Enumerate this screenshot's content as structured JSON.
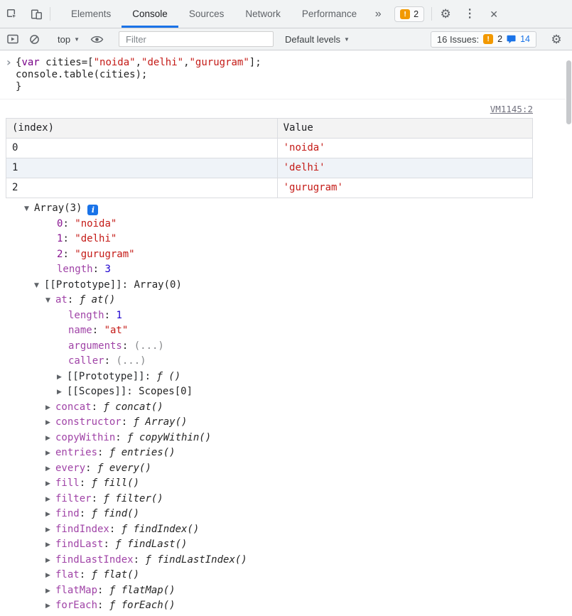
{
  "colors": {
    "accent_blue": "#1a73e8",
    "string_red": "#c41a16",
    "property_purple": "#881391",
    "number_blue": "#1c00cf",
    "warning_amber": "#f29900"
  },
  "icons": {
    "warning": "!",
    "info": "i",
    "more_tabs": "»",
    "overflow_menu": "⋮",
    "close": "✕",
    "settings": "⚙",
    "caret_down": "▼",
    "input_chevron": "›",
    "tree_open": "▼",
    "tree_closed": "▶"
  },
  "tabbar": {
    "tabs": [
      {
        "label": "Elements",
        "active": false
      },
      {
        "label": "Console",
        "active": true
      },
      {
        "label": "Sources",
        "active": false
      },
      {
        "label": "Network",
        "active": false
      },
      {
        "label": "Performance",
        "active": false
      }
    ],
    "issues_badge_count": "2"
  },
  "toolbar": {
    "context_value": "top",
    "filter_placeholder": "Filter",
    "filter_value": "",
    "levels_value": "Default levels",
    "issues_label": "16 Issues:",
    "issues_error_count": "2",
    "issues_message_count": "14"
  },
  "console": {
    "input_lines": [
      [
        {
          "t": "{",
          "s": "plain"
        },
        {
          "t": "var",
          "s": "keyword"
        },
        {
          "t": " cities=[",
          "s": "plain"
        },
        {
          "t": "\"noida\"",
          "s": "string"
        },
        {
          "t": ",",
          "s": "plain"
        },
        {
          "t": "\"delhi\"",
          "s": "string"
        },
        {
          "t": ",",
          "s": "plain"
        },
        {
          "t": "\"gurugram\"",
          "s": "string"
        },
        {
          "t": "];",
          "s": "plain"
        }
      ],
      [
        {
          "t": "console.table(cities);",
          "s": "plain"
        }
      ],
      [
        {
          "t": "}",
          "s": "plain"
        }
      ]
    ],
    "message": {
      "source_link": "VM1145:2",
      "table": {
        "headers": [
          "(index)",
          "Value"
        ],
        "rows": [
          {
            "index": "0",
            "value": "'noida'"
          },
          {
            "index": "1",
            "value": "'delhi'"
          },
          {
            "index": "2",
            "value": "'gurugram'"
          }
        ]
      }
    },
    "result_tree": {
      "root_label": "Array(3)",
      "root_expanded": true,
      "rows": [
        {
          "key": "0",
          "value": "\"noida\"",
          "vtype": "string",
          "depth": 1,
          "expand": "none",
          "enumerable": true
        },
        {
          "key": "1",
          "value": "\"delhi\"",
          "vtype": "string",
          "depth": 1,
          "expand": "none",
          "enumerable": true
        },
        {
          "key": "2",
          "value": "\"gurugram\"",
          "vtype": "string",
          "depth": 1,
          "expand": "none",
          "enumerable": true
        },
        {
          "key": "length",
          "value": "3",
          "vtype": "number",
          "depth": 1,
          "expand": "none"
        },
        {
          "key": "[[Prototype]]",
          "value": "Array(0)",
          "vtype": "plain",
          "depth": 1,
          "expand": "open",
          "internal": true
        },
        {
          "key": "at",
          "value": "ƒ at()",
          "vtype": "function",
          "depth": 2,
          "expand": "open"
        },
        {
          "key": "length",
          "value": "1",
          "vtype": "number",
          "depth": 3,
          "expand": "none"
        },
        {
          "key": "name",
          "value": "\"at\"",
          "vtype": "string",
          "depth": 3,
          "expand": "none"
        },
        {
          "key": "arguments",
          "value": "(...)",
          "vtype": "muted",
          "depth": 3,
          "expand": "none"
        },
        {
          "key": "caller",
          "value": "(...)",
          "vtype": "muted",
          "depth": 3,
          "expand": "none"
        },
        {
          "key": "[[Prototype]]",
          "value": "ƒ ()",
          "vtype": "function",
          "depth": 3,
          "expand": "closed",
          "internal": true
        },
        {
          "key": "[[Scopes]]",
          "value": "Scopes[0]",
          "vtype": "plain",
          "depth": 3,
          "expand": "closed",
          "internal": true
        },
        {
          "key": "concat",
          "value": "ƒ concat()",
          "vtype": "function",
          "depth": 2,
          "expand": "closed"
        },
        {
          "key": "constructor",
          "value": "ƒ Array()",
          "vtype": "function",
          "depth": 2,
          "expand": "closed"
        },
        {
          "key": "copyWithin",
          "value": "ƒ copyWithin()",
          "vtype": "function",
          "depth": 2,
          "expand": "closed"
        },
        {
          "key": "entries",
          "value": "ƒ entries()",
          "vtype": "function",
          "depth": 2,
          "expand": "closed"
        },
        {
          "key": "every",
          "value": "ƒ every()",
          "vtype": "function",
          "depth": 2,
          "expand": "closed"
        },
        {
          "key": "fill",
          "value": "ƒ fill()",
          "vtype": "function",
          "depth": 2,
          "expand": "closed"
        },
        {
          "key": "filter",
          "value": "ƒ filter()",
          "vtype": "function",
          "depth": 2,
          "expand": "closed"
        },
        {
          "key": "find",
          "value": "ƒ find()",
          "vtype": "function",
          "depth": 2,
          "expand": "closed"
        },
        {
          "key": "findIndex",
          "value": "ƒ findIndex()",
          "vtype": "function",
          "depth": 2,
          "expand": "closed"
        },
        {
          "key": "findLast",
          "value": "ƒ findLast()",
          "vtype": "function",
          "depth": 2,
          "expand": "closed"
        },
        {
          "key": "findLastIndex",
          "value": "ƒ findLastIndex()",
          "vtype": "function",
          "depth": 2,
          "expand": "closed"
        },
        {
          "key": "flat",
          "value": "ƒ flat()",
          "vtype": "function",
          "depth": 2,
          "expand": "closed"
        },
        {
          "key": "flatMap",
          "value": "ƒ flatMap()",
          "vtype": "function",
          "depth": 2,
          "expand": "closed"
        },
        {
          "key": "forEach",
          "value": "ƒ forEach()",
          "vtype": "function",
          "depth": 2,
          "expand": "closed"
        }
      ]
    }
  }
}
